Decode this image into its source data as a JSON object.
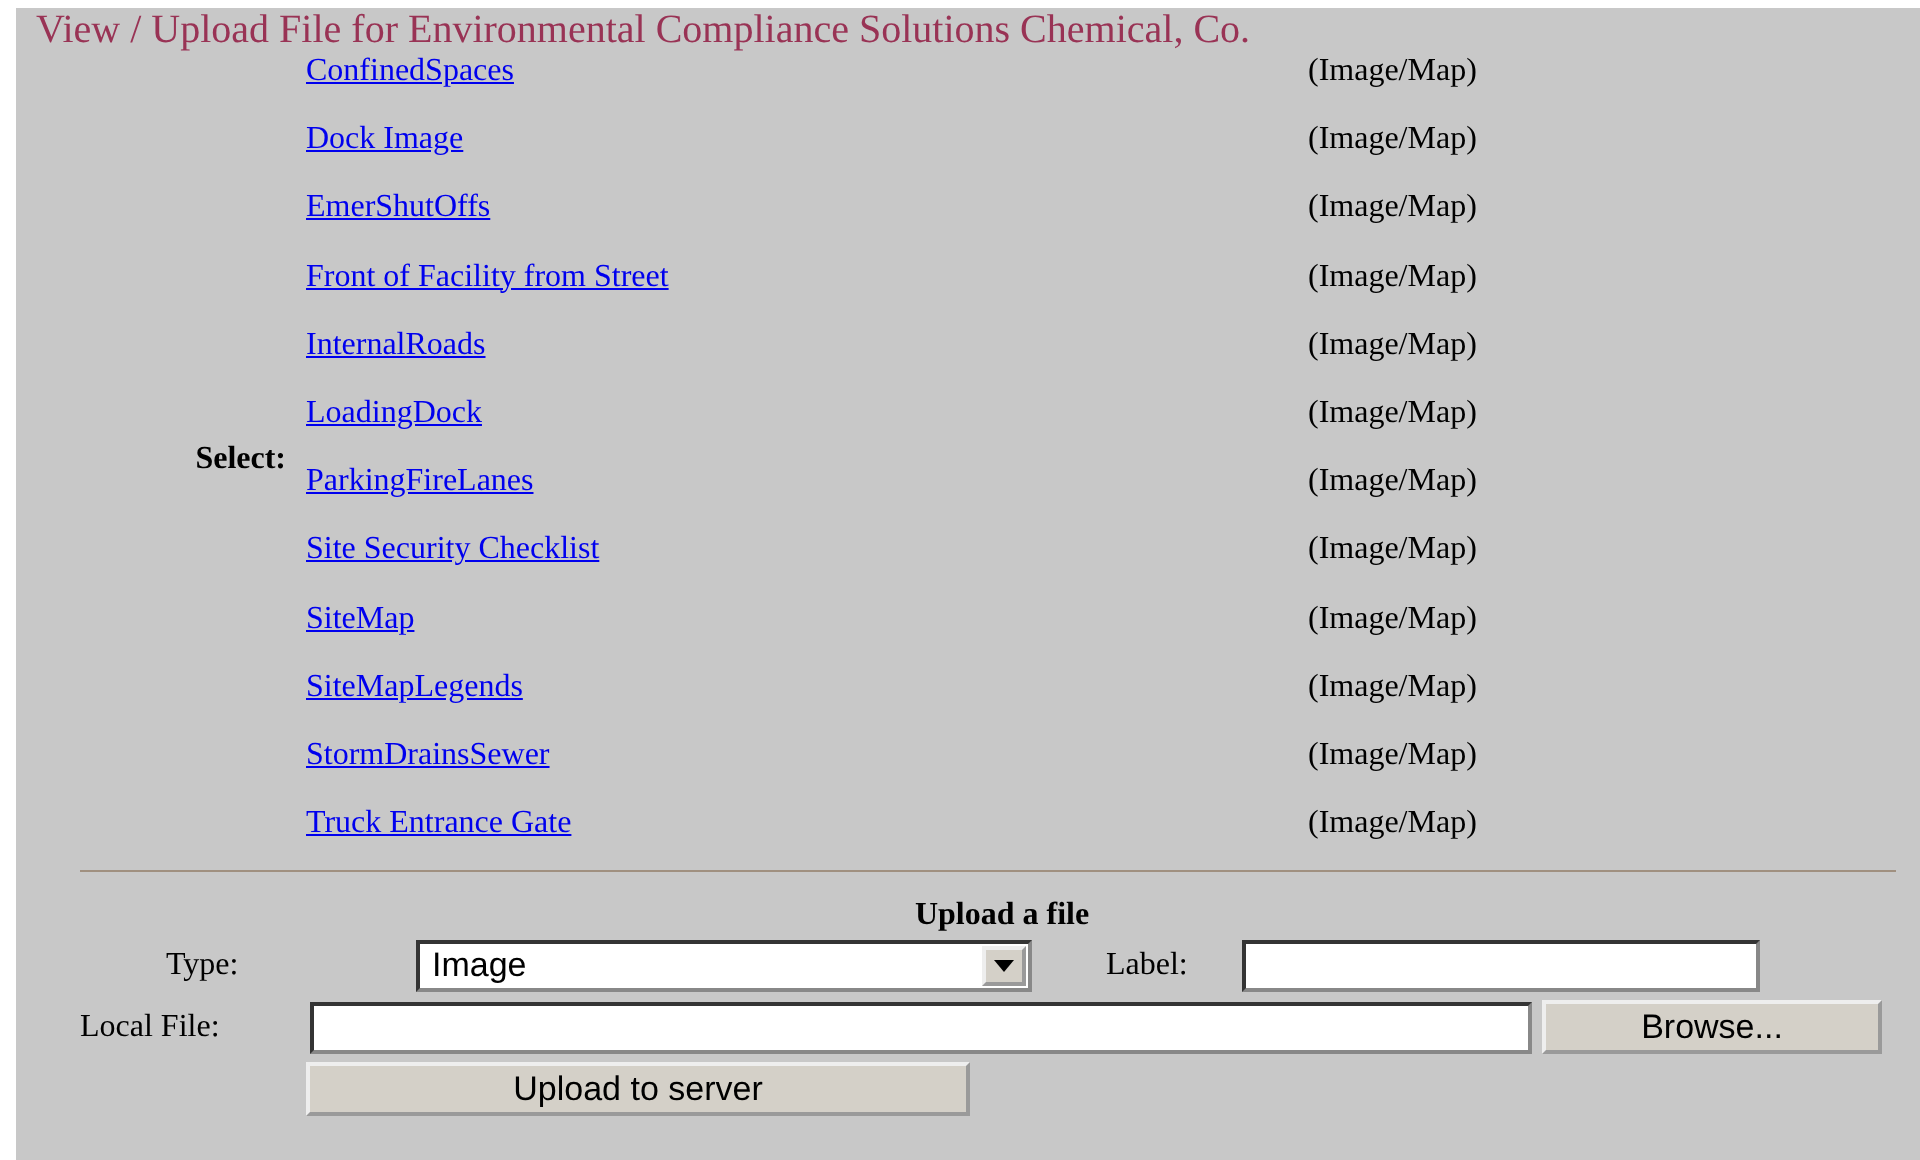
{
  "title": "View / Upload File for Environmental Compliance Solutions Chemical, Co.",
  "select_label": "Select:",
  "files": [
    {
      "name": "ConfinedSpaces",
      "type": "(Image/Map)"
    },
    {
      "name": "Dock Image",
      "type": "(Image/Map)"
    },
    {
      "name": "EmerShutOffs",
      "type": "(Image/Map)"
    },
    {
      "name": "Front of Facility from Street",
      "type": "(Image/Map)"
    },
    {
      "name": "InternalRoads",
      "type": "(Image/Map)"
    },
    {
      "name": "LoadingDock",
      "type": "(Image/Map)"
    },
    {
      "name": "ParkingFireLanes",
      "type": "(Image/Map)"
    },
    {
      "name": "Site Security Checklist",
      "type": "(Image/Map)"
    },
    {
      "name": "SiteMap",
      "type": "(Image/Map)"
    },
    {
      "name": "SiteMapLegends",
      "type": "(Image/Map)"
    },
    {
      "name": "StormDrainsSewer",
      "type": "(Image/Map)"
    },
    {
      "name": "Truck Entrance Gate",
      "type": "(Image/Map)"
    }
  ],
  "upload": {
    "heading": "Upload a file",
    "type_label": "Type:",
    "type_value": "Image",
    "label_label": "Label:",
    "local_file_label": "Local File:",
    "browse_button": "Browse...",
    "submit_button": "Upload to server"
  }
}
